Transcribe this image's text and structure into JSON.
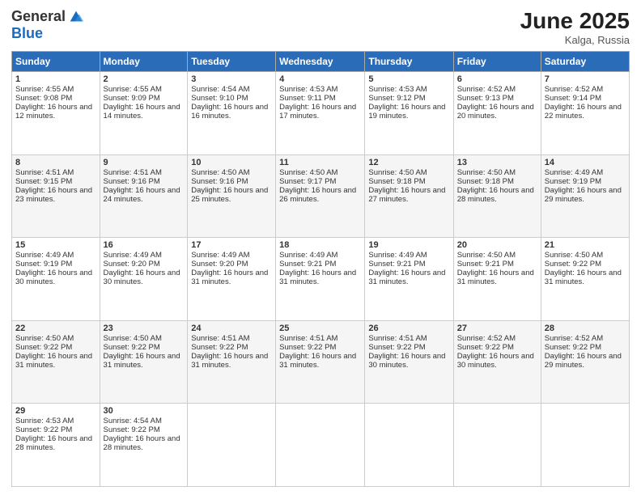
{
  "header": {
    "logo_general": "General",
    "logo_blue": "Blue",
    "month_title": "June 2025",
    "location": "Kalga, Russia"
  },
  "days_of_week": [
    "Sunday",
    "Monday",
    "Tuesday",
    "Wednesday",
    "Thursday",
    "Friday",
    "Saturday"
  ],
  "weeks": [
    [
      {
        "day": "1",
        "sunrise": "4:55 AM",
        "sunset": "9:08 PM",
        "daylight": "16 hours and 12 minutes."
      },
      {
        "day": "2",
        "sunrise": "4:55 AM",
        "sunset": "9:09 PM",
        "daylight": "16 hours and 14 minutes."
      },
      {
        "day": "3",
        "sunrise": "4:54 AM",
        "sunset": "9:10 PM",
        "daylight": "16 hours and 16 minutes."
      },
      {
        "day": "4",
        "sunrise": "4:53 AM",
        "sunset": "9:11 PM",
        "daylight": "16 hours and 17 minutes."
      },
      {
        "day": "5",
        "sunrise": "4:53 AM",
        "sunset": "9:12 PM",
        "daylight": "16 hours and 19 minutes."
      },
      {
        "day": "6",
        "sunrise": "4:52 AM",
        "sunset": "9:13 PM",
        "daylight": "16 hours and 20 minutes."
      },
      {
        "day": "7",
        "sunrise": "4:52 AM",
        "sunset": "9:14 PM",
        "daylight": "16 hours and 22 minutes."
      }
    ],
    [
      {
        "day": "8",
        "sunrise": "4:51 AM",
        "sunset": "9:15 PM",
        "daylight": "16 hours and 23 minutes."
      },
      {
        "day": "9",
        "sunrise": "4:51 AM",
        "sunset": "9:16 PM",
        "daylight": "16 hours and 24 minutes."
      },
      {
        "day": "10",
        "sunrise": "4:50 AM",
        "sunset": "9:16 PM",
        "daylight": "16 hours and 25 minutes."
      },
      {
        "day": "11",
        "sunrise": "4:50 AM",
        "sunset": "9:17 PM",
        "daylight": "16 hours and 26 minutes."
      },
      {
        "day": "12",
        "sunrise": "4:50 AM",
        "sunset": "9:18 PM",
        "daylight": "16 hours and 27 minutes."
      },
      {
        "day": "13",
        "sunrise": "4:50 AM",
        "sunset": "9:18 PM",
        "daylight": "16 hours and 28 minutes."
      },
      {
        "day": "14",
        "sunrise": "4:49 AM",
        "sunset": "9:19 PM",
        "daylight": "16 hours and 29 minutes."
      }
    ],
    [
      {
        "day": "15",
        "sunrise": "4:49 AM",
        "sunset": "9:19 PM",
        "daylight": "16 hours and 30 minutes."
      },
      {
        "day": "16",
        "sunrise": "4:49 AM",
        "sunset": "9:20 PM",
        "daylight": "16 hours and 30 minutes."
      },
      {
        "day": "17",
        "sunrise": "4:49 AM",
        "sunset": "9:20 PM",
        "daylight": "16 hours and 31 minutes."
      },
      {
        "day": "18",
        "sunrise": "4:49 AM",
        "sunset": "9:21 PM",
        "daylight": "16 hours and 31 minutes."
      },
      {
        "day": "19",
        "sunrise": "4:49 AM",
        "sunset": "9:21 PM",
        "daylight": "16 hours and 31 minutes."
      },
      {
        "day": "20",
        "sunrise": "4:50 AM",
        "sunset": "9:21 PM",
        "daylight": "16 hours and 31 minutes."
      },
      {
        "day": "21",
        "sunrise": "4:50 AM",
        "sunset": "9:22 PM",
        "daylight": "16 hours and 31 minutes."
      }
    ],
    [
      {
        "day": "22",
        "sunrise": "4:50 AM",
        "sunset": "9:22 PM",
        "daylight": "16 hours and 31 minutes."
      },
      {
        "day": "23",
        "sunrise": "4:50 AM",
        "sunset": "9:22 PM",
        "daylight": "16 hours and 31 minutes."
      },
      {
        "day": "24",
        "sunrise": "4:51 AM",
        "sunset": "9:22 PM",
        "daylight": "16 hours and 31 minutes."
      },
      {
        "day": "25",
        "sunrise": "4:51 AM",
        "sunset": "9:22 PM",
        "daylight": "16 hours and 31 minutes."
      },
      {
        "day": "26",
        "sunrise": "4:51 AM",
        "sunset": "9:22 PM",
        "daylight": "16 hours and 30 minutes."
      },
      {
        "day": "27",
        "sunrise": "4:52 AM",
        "sunset": "9:22 PM",
        "daylight": "16 hours and 30 minutes."
      },
      {
        "day": "28",
        "sunrise": "4:52 AM",
        "sunset": "9:22 PM",
        "daylight": "16 hours and 29 minutes."
      }
    ],
    [
      {
        "day": "29",
        "sunrise": "4:53 AM",
        "sunset": "9:22 PM",
        "daylight": "16 hours and 28 minutes."
      },
      {
        "day": "30",
        "sunrise": "4:54 AM",
        "sunset": "9:22 PM",
        "daylight": "16 hours and 28 minutes."
      },
      null,
      null,
      null,
      null,
      null
    ]
  ],
  "labels": {
    "sunrise": "Sunrise:",
    "sunset": "Sunset:",
    "daylight": "Daylight:"
  }
}
